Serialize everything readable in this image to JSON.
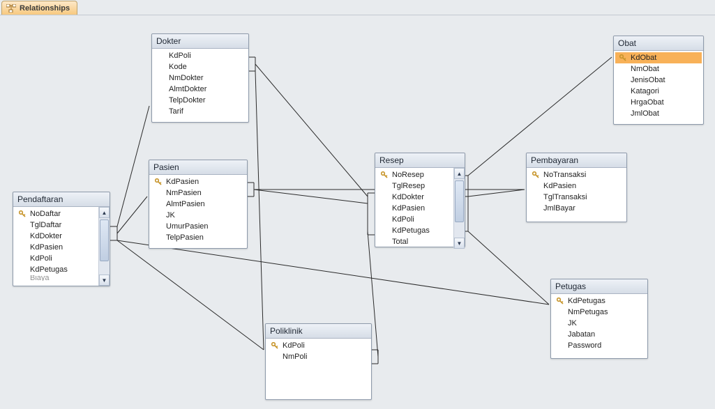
{
  "tab": {
    "title": "Relationships"
  },
  "tables": {
    "pendaftaran": {
      "title": "Pendaftaran",
      "fields": [
        {
          "name": "NoDaftar",
          "pk": true
        },
        {
          "name": "TglDaftar",
          "pk": false
        },
        {
          "name": "KdDokter",
          "pk": false
        },
        {
          "name": "KdPasien",
          "pk": false
        },
        {
          "name": "KdPoli",
          "pk": false
        },
        {
          "name": "KdPetugas",
          "pk": false
        },
        {
          "name": "Biaya",
          "pk": false
        }
      ]
    },
    "dokter": {
      "title": "Dokter",
      "fields": [
        {
          "name": "KdPoli",
          "pk": false
        },
        {
          "name": "Kode",
          "pk": false
        },
        {
          "name": "NmDokter",
          "pk": false
        },
        {
          "name": "AlmtDokter",
          "pk": false
        },
        {
          "name": "TelpDokter",
          "pk": false
        },
        {
          "name": "Tarif",
          "pk": false
        }
      ]
    },
    "pasien": {
      "title": "Pasien",
      "fields": [
        {
          "name": "KdPasien",
          "pk": true
        },
        {
          "name": "NmPasien",
          "pk": false
        },
        {
          "name": "AlmtPasien",
          "pk": false
        },
        {
          "name": "JK",
          "pk": false
        },
        {
          "name": "UmurPasien",
          "pk": false
        },
        {
          "name": "TelpPasien",
          "pk": false
        }
      ]
    },
    "poliklinik": {
      "title": "Poliklinik",
      "fields": [
        {
          "name": "KdPoli",
          "pk": true
        },
        {
          "name": "NmPoli",
          "pk": false
        }
      ]
    },
    "resep": {
      "title": "Resep",
      "fields": [
        {
          "name": "NoResep",
          "pk": true
        },
        {
          "name": "TglResep",
          "pk": false
        },
        {
          "name": "KdDokter",
          "pk": false
        },
        {
          "name": "KdPasien",
          "pk": false
        },
        {
          "name": "KdPoli",
          "pk": false
        },
        {
          "name": "KdPetugas",
          "pk": false
        },
        {
          "name": "Total",
          "pk": false
        }
      ]
    },
    "obat": {
      "title": "Obat",
      "fields": [
        {
          "name": "KdObat",
          "pk": true
        },
        {
          "name": "NmObat",
          "pk": false
        },
        {
          "name": "JenisObat",
          "pk": false
        },
        {
          "name": "Katagori",
          "pk": false
        },
        {
          "name": "HrgaObat",
          "pk": false
        },
        {
          "name": "JmlObat",
          "pk": false
        }
      ]
    },
    "pembayaran": {
      "title": "Pembayaran",
      "fields": [
        {
          "name": "NoTransaksi",
          "pk": true
        },
        {
          "name": "KdPasien",
          "pk": false
        },
        {
          "name": "TglTransaksi",
          "pk": false
        },
        {
          "name": "JmlBayar",
          "pk": false
        }
      ]
    },
    "petugas": {
      "title": "Petugas",
      "fields": [
        {
          "name": "KdPetugas",
          "pk": true
        },
        {
          "name": "NmPetugas",
          "pk": false
        },
        {
          "name": "JK",
          "pk": false
        },
        {
          "name": "Jabatan",
          "pk": false
        },
        {
          "name": "Password",
          "pk": false
        }
      ]
    }
  }
}
